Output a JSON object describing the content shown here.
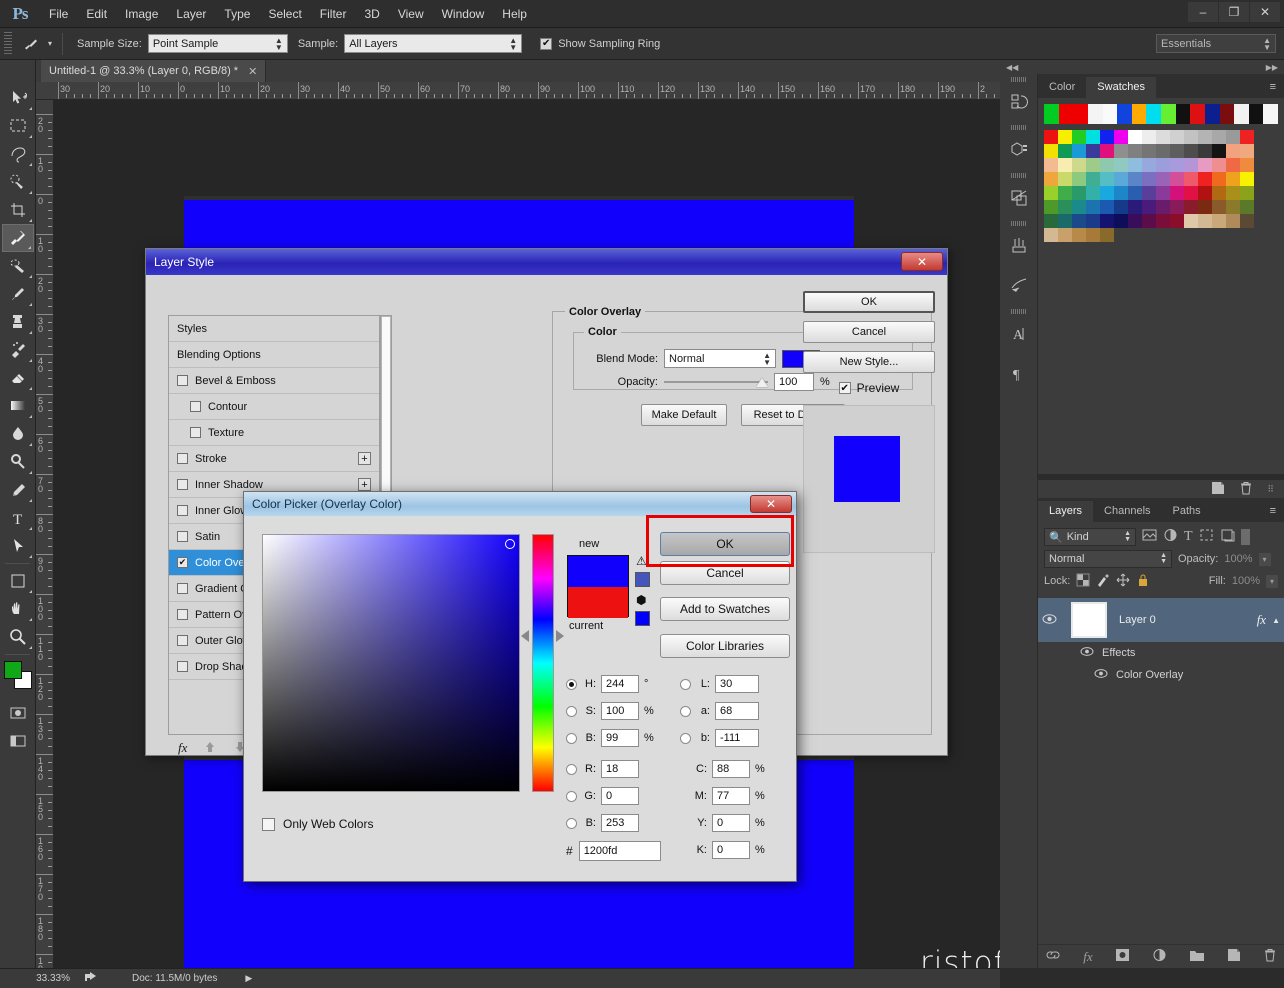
{
  "app": {
    "logo": "Ps",
    "menus": [
      "File",
      "Edit",
      "Image",
      "Layer",
      "Type",
      "Select",
      "Filter",
      "3D",
      "View",
      "Window",
      "Help"
    ],
    "window_controls": {
      "minimize": "–",
      "restore": "❐",
      "close": "✕"
    }
  },
  "options_bar": {
    "sample_size_label": "Sample Size:",
    "sample_size_value": "Point Sample",
    "sample_label": "Sample:",
    "sample_value": "All Layers",
    "show_sampling_ring_label": "Show Sampling Ring",
    "show_sampling_ring_checked": true,
    "workspace": "Essentials"
  },
  "document": {
    "tab_title": "Untitled-1 @ 33.3% (Layer 0, RGB/8) *",
    "close_glyph": "✕"
  },
  "rulers": {
    "horizontal": [
      "30",
      "20",
      "10",
      "0",
      "10",
      "20",
      "30",
      "40",
      "50",
      "60",
      "70",
      "80",
      "90",
      "100",
      "110",
      "120",
      "130",
      "140",
      "150",
      "160",
      "170",
      "180",
      "190",
      "2"
    ],
    "vertical": [
      "20",
      "10",
      "0",
      "10",
      "20",
      "30",
      "40",
      "50",
      "60",
      "70",
      "80",
      "90",
      "100",
      "110",
      "120",
      "130",
      "140",
      "150",
      "160",
      "170",
      "180",
      "19"
    ]
  },
  "tools": [
    "move-tool",
    "marquee-tool",
    "lasso-tool",
    "quick-selection-tool",
    "crop-tool",
    "eyedropper-tool",
    "healing-brush-tool",
    "brush-tool",
    "clone-stamp-tool",
    "history-brush-tool",
    "eraser-tool",
    "gradient-tool",
    "blur-tool",
    "dodge-tool",
    "pen-tool",
    "type-tool",
    "path-selection-tool",
    "line-tool",
    "hand-tool",
    "zoom-tool"
  ],
  "status_bar": {
    "zoom": "33.33%",
    "doc_info": "Doc: 11.5M/0 bytes"
  },
  "canvas": {
    "watermark": "ristofa.com",
    "fill_color": "#1200fd"
  },
  "swatches_panel": {
    "tabs": [
      "Color",
      "Swatches"
    ],
    "active_tab": "Swatches",
    "menu_glyph": "≡",
    "recent": [
      "#00cc22",
      "#ee0000",
      "#ee0000",
      "#f4f4f4",
      "#fafafa",
      "#1144dd",
      "#ffaa00",
      "#00ddee",
      "#66ee33",
      "#111111",
      "#dd1111",
      "#0b1f8f",
      "#7a0e0e",
      "#f2f2f2",
      "#111111",
      "#f6f6f6"
    ],
    "grid": [
      "#ee1111",
      "#f6f000",
      "#22cc22",
      "#00e0e0",
      "#1122ee",
      "#ee00ee",
      "#ffffff",
      "#ededed",
      "#dcdcdc",
      "#d0d0d0",
      "#c2c2c2",
      "#b4b4b4",
      "#a8a8a8",
      "#9a9a9a",
      "#ee2222",
      "#f2e000",
      "#0f9a55",
      "#1b9ada",
      "#3a3a9a",
      "#e0117a",
      "#8f8f8f",
      "#808080",
      "#757575",
      "#6b6b6b",
      "#5e5e5e",
      "#4d4d4d",
      "#3a3a3a",
      "#141414",
      "#f2a27c",
      "#f0a97e",
      "#f3bb92",
      "#f7edb0",
      "#cfd98c",
      "#9ecb8a",
      "#8ec9ae",
      "#8fc9c2",
      "#8fbddd",
      "#96a8dd",
      "#9c9ddb",
      "#a99add",
      "#b695d6",
      "#e79ac2",
      "#ef8e8e",
      "#ef6a44",
      "#ef8b3c",
      "#efa63c",
      "#c9d96a",
      "#8dc97f",
      "#3fae94",
      "#55bdc4",
      "#5aa9d8",
      "#5a86c8",
      "#7a6fc0",
      "#9a63b8",
      "#d44f9a",
      "#ef5a6a",
      "#ef2222",
      "#ef6a1e",
      "#efa21e",
      "#f7f200",
      "#9ad02a",
      "#3fae4a",
      "#2a9a6a",
      "#33b0a8",
      "#19a8e0",
      "#1d86c8",
      "#2a5fb0",
      "#5a3f9a",
      "#8a3a9a",
      "#d4117a",
      "#e01144",
      "#b01111",
      "#b06a11",
      "#a8901b",
      "#8aa31b",
      "#4d9a2a",
      "#2a8f5a",
      "#1b8a8a",
      "#1b74b0",
      "#1b5ab0",
      "#153a8a",
      "#2a1b7a",
      "#4a1b7a",
      "#6a1b6a",
      "#8a1b5a",
      "#8a1b2a",
      "#7a2a11",
      "#8a5a2a",
      "#8a7a2a",
      "#5a7a2a",
      "#2a6a3a",
      "#1b6a6a",
      "#1b4a8a",
      "#1b3a8a",
      "#141470",
      "#0d0d5a",
      "#3a0d5a",
      "#5a0d4a",
      "#7a0d3a",
      "#8a0d2a",
      "#e0c9a8",
      "#d4b894",
      "#c9a87a",
      "#b08a5a",
      "#5a4a33",
      "#d4b894",
      "#c9a06a",
      "#b88a4a",
      "#a87a3a",
      "#8a6a2a"
    ]
  },
  "layers_panel": {
    "tabs": [
      "Layers",
      "Channels",
      "Paths"
    ],
    "active_tab": "Layers",
    "menu_glyph": "≡",
    "filter_value": "Kind",
    "blend_mode": "Normal",
    "opacity_label": "Opacity:",
    "opacity_value": "100%",
    "lock_label": "Lock:",
    "fill_label": "Fill:",
    "fill_value": "100%",
    "layer_name": "Layer 0",
    "fx_badge": "fx",
    "effects_label": "Effects",
    "effect_name": "Color Overlay"
  },
  "layer_style_dialog": {
    "title": "Layer Style",
    "close_glyph": "✕",
    "styles": [
      {
        "label": "Styles",
        "checkbox": false,
        "indent": false,
        "plus": false,
        "selected": false
      },
      {
        "label": "Blending Options",
        "checkbox": false,
        "indent": false,
        "plus": false,
        "selected": false
      },
      {
        "label": "Bevel & Emboss",
        "checkbox": true,
        "checked": false,
        "indent": false,
        "plus": false,
        "selected": false
      },
      {
        "label": "Contour",
        "checkbox": true,
        "checked": false,
        "indent": true,
        "plus": false,
        "selected": false
      },
      {
        "label": "Texture",
        "checkbox": true,
        "checked": false,
        "indent": true,
        "plus": false,
        "selected": false
      },
      {
        "label": "Stroke",
        "checkbox": true,
        "checked": false,
        "indent": false,
        "plus": true,
        "selected": false
      },
      {
        "label": "Inner Shadow",
        "checkbox": true,
        "checked": false,
        "indent": false,
        "plus": true,
        "selected": false
      },
      {
        "label": "Inner Glow",
        "checkbox": true,
        "checked": false,
        "indent": false,
        "plus": false,
        "selected": false
      },
      {
        "label": "Satin",
        "checkbox": true,
        "checked": false,
        "indent": false,
        "plus": false,
        "selected": false
      },
      {
        "label": "Color Overlay",
        "checkbox": true,
        "checked": true,
        "indent": false,
        "plus": true,
        "selected": true
      },
      {
        "label": "Gradient Overlay",
        "checkbox": true,
        "checked": false,
        "indent": false,
        "plus": true,
        "selected": false
      },
      {
        "label": "Pattern Overlay",
        "checkbox": true,
        "checked": false,
        "indent": false,
        "plus": false,
        "selected": false
      },
      {
        "label": "Outer Glow",
        "checkbox": true,
        "checked": false,
        "indent": false,
        "plus": false,
        "selected": false
      },
      {
        "label": "Drop Shadow",
        "checkbox": true,
        "checked": false,
        "indent": false,
        "plus": true,
        "selected": false
      }
    ],
    "fx_glyph": "fx",
    "section_title": "Color Overlay",
    "group_title": "Color",
    "blend_mode_label": "Blend Mode:",
    "blend_mode_value": "Normal",
    "overlay_color": "#1200fd",
    "opacity_label": "Opacity:",
    "opacity_value": "100",
    "percent": "%",
    "make_default": "Make Default",
    "reset_to_default": "Reset to Default",
    "ok": "OK",
    "cancel": "Cancel",
    "new_style": "New Style...",
    "preview_label": "Preview",
    "preview_checked": true,
    "preview_swatch": "#1200fd"
  },
  "color_picker": {
    "title": "Color Picker (Overlay Color)",
    "close_glyph": "✕",
    "new_label": "new",
    "current_label": "current",
    "new_color": "#1200fd",
    "current_color": "#ee1111",
    "ok": "OK",
    "cancel": "Cancel",
    "add_to_swatches": "Add to Swatches",
    "color_libraries": "Color Libraries",
    "only_web_colors_label": "Only Web Colors",
    "only_web_colors_checked": false,
    "hex_symbol": "#",
    "hex_value": "1200fd",
    "hsb": [
      {
        "key": "H:",
        "value": "244",
        "unit": "°",
        "selected": true
      },
      {
        "key": "S:",
        "value": "100",
        "unit": "%",
        "selected": false
      },
      {
        "key": "B:",
        "value": "99",
        "unit": "%",
        "selected": false
      }
    ],
    "rgb": [
      {
        "key": "R:",
        "value": "18",
        "unit": "",
        "selected": false
      },
      {
        "key": "G:",
        "value": "0",
        "unit": "",
        "selected": false
      },
      {
        "key": "B:",
        "value": "253",
        "unit": "",
        "selected": false
      }
    ],
    "lab": [
      {
        "key": "L:",
        "value": "30",
        "unit": "",
        "selected": false
      },
      {
        "key": "a:",
        "value": "68",
        "unit": "",
        "selected": false
      },
      {
        "key": "b:",
        "value": "-111",
        "unit": "",
        "selected": false
      }
    ],
    "cmyk": [
      {
        "key": "C:",
        "value": "88",
        "unit": "%"
      },
      {
        "key": "M:",
        "value": "77",
        "unit": "%"
      },
      {
        "key": "Y:",
        "value": "0",
        "unit": "%"
      },
      {
        "key": "K:",
        "value": "0",
        "unit": "%"
      }
    ],
    "out_of_gamut_glyph": "⚠",
    "web_safe_glyph": "⬢",
    "gamut_alt_color": "#4455bb",
    "websafe_alt_color": "#0000ff",
    "highlight_color": "#e80000"
  }
}
